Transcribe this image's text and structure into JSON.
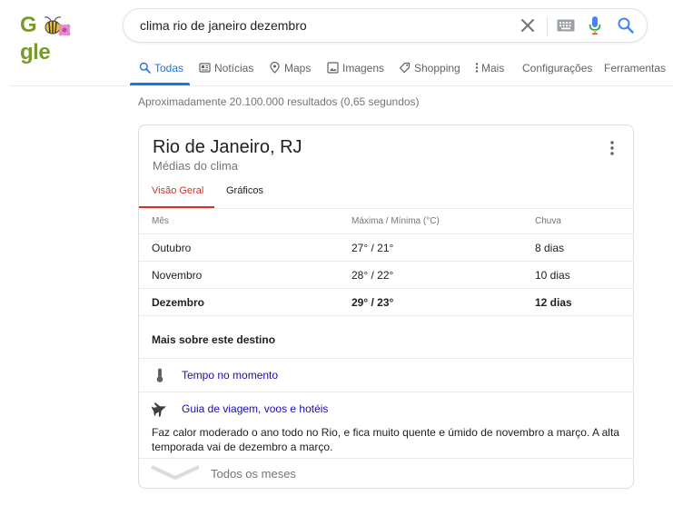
{
  "logo": {
    "prefix": "G",
    "suffix": "gle"
  },
  "search": {
    "query": "clima rio de janeiro dezembro"
  },
  "tabs": [
    {
      "label": "Todas"
    },
    {
      "label": "Notícias"
    },
    {
      "label": "Maps"
    },
    {
      "label": "Imagens"
    },
    {
      "label": "Shopping"
    },
    {
      "label": "Mais"
    },
    {
      "label": "Configurações"
    },
    {
      "label": "Ferramentas"
    }
  ],
  "result_stats": "Aproximadamente 20.100.000 resultados (0,65 segundos)",
  "card": {
    "title": "Rio de Janeiro, RJ",
    "subtitle": "Médias do clima",
    "tabs": {
      "overview": "Visão Geral",
      "charts": "Gráficos"
    },
    "table": {
      "headers": {
        "month": "Mês",
        "temp": "Máxima / Mínima (°C)",
        "rain": "Chuva"
      },
      "rows": [
        {
          "month": "Outubro",
          "temp": "27° / 21°",
          "rain": "8 dias"
        },
        {
          "month": "Novembro",
          "temp": "28° / 22°",
          "rain": "10 dias"
        },
        {
          "month": "Dezembro",
          "temp": "29° / 23°",
          "rain": "12 dias"
        }
      ]
    },
    "more": {
      "title": "Mais sobre este destino",
      "links": [
        {
          "label": "Tempo no momento",
          "icon": "thermometer-icon"
        },
        {
          "label": "Guia de viagem, voos e hotéis",
          "icon": "airplane-icon"
        }
      ]
    },
    "description": "Faz calor moderado o ano todo no Rio, e fica muito quente e úmido de novembro a março. A alta temporada vai de dezembro a março.",
    "expand_label": "Todos os meses"
  },
  "colors": {
    "accent_blue": "#1a73e8",
    "link": "#1a0dab",
    "tab_red": "#d93025",
    "muted": "#70757a"
  }
}
